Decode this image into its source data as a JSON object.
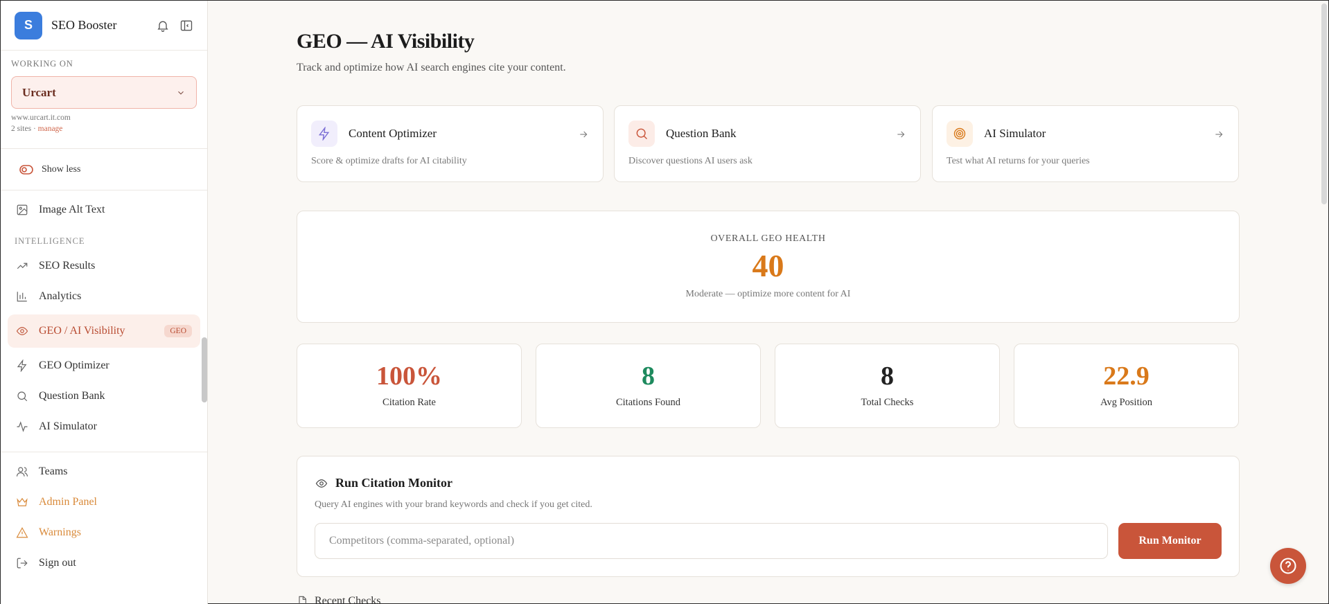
{
  "sidebar": {
    "logo_letter": "S",
    "app_name": "SEO Booster",
    "working_label": "WORKING ON",
    "site_name": "Urcart",
    "site_url": "www.urcart.it.com",
    "site_count": "2 sites · ",
    "manage_label": "manage",
    "show_less": "Show less",
    "image_alt": "Image Alt Text",
    "intelligence_label": "INTELLIGENCE",
    "items": {
      "seo_results": "SEO Results",
      "analytics": "Analytics",
      "geo_visibility": "GEO / AI Visibility",
      "geo_badge": "GEO",
      "geo_optimizer": "GEO Optimizer",
      "question_bank": "Question Bank",
      "ai_simulator": "AI Simulator"
    },
    "teams": "Teams",
    "admin_panel": "Admin Panel",
    "warnings": "Warnings",
    "sign_out": "Sign out"
  },
  "main": {
    "title": "GEO — AI Visibility",
    "subtitle": "Track and optimize how AI search engines cite your content.",
    "tools": [
      {
        "name": "Content Optimizer",
        "desc": "Score & optimize drafts for AI citability",
        "icon": "lightning-icon",
        "color": "#7c6fd6",
        "bg": "#f1eefc"
      },
      {
        "name": "Question Bank",
        "desc": "Discover questions AI users ask",
        "icon": "search-icon",
        "color": "#c9553a",
        "bg": "#fcece7"
      },
      {
        "name": "AI Simulator",
        "desc": "Test what AI returns for your queries",
        "icon": "target-icon",
        "color": "#d9791a",
        "bg": "#fdf1e4"
      }
    ],
    "health": {
      "label": "OVERALL GEO HEALTH",
      "score": "40",
      "desc": "Moderate — optimize more content for AI",
      "color": "#d9791a"
    },
    "stats": [
      {
        "value": "100%",
        "label": "Citation Rate",
        "color": "#c9553a"
      },
      {
        "value": "8",
        "label": "Citations Found",
        "color": "#1e8a5e"
      },
      {
        "value": "8",
        "label": "Total Checks",
        "color": "#222222"
      },
      {
        "value": "22.9",
        "label": "Avg Position",
        "color": "#d9791a"
      }
    ],
    "monitor": {
      "title": "Run Citation Monitor",
      "desc": "Query AI engines with your brand keywords and check if you get cited.",
      "placeholder": "Competitors (comma-separated, optional)",
      "value": "",
      "button": "Run Monitor"
    },
    "next_section": "Recent Checks"
  }
}
